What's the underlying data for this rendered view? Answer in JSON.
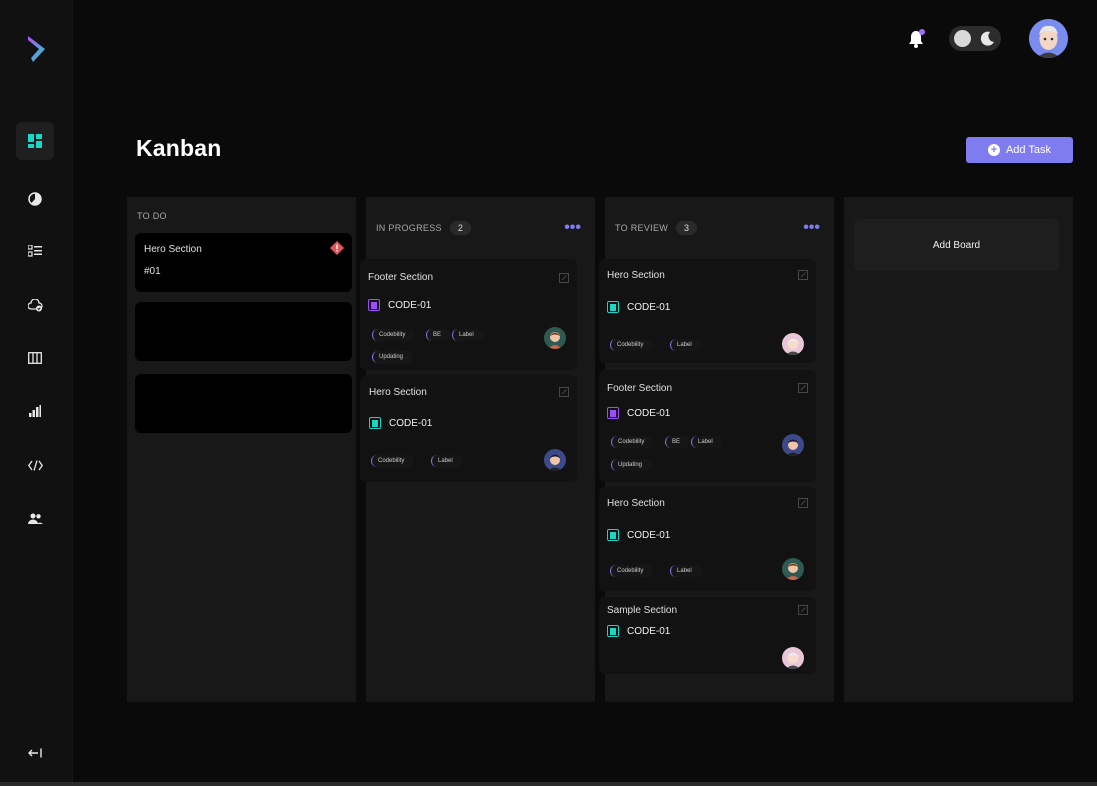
{
  "header": {
    "title": "Kanban",
    "add_task_label": "Add Task",
    "notification_icon": "bell-icon",
    "theme_toggle_icon": "moon-icon"
  },
  "sidebar": {
    "items": [
      {
        "name": "dashboard",
        "icon": "grid-icon",
        "active": true
      },
      {
        "name": "analytics",
        "icon": "pie-chart-icon"
      },
      {
        "name": "tasks",
        "icon": "checklist-icon"
      },
      {
        "name": "cloud",
        "icon": "cloud-check-icon"
      },
      {
        "name": "kanban",
        "icon": "columns-icon"
      },
      {
        "name": "reports",
        "icon": "bar-chart-icon"
      },
      {
        "name": "code",
        "icon": "code-icon"
      },
      {
        "name": "team",
        "icon": "users-icon"
      }
    ],
    "logout_icon": "logout-icon"
  },
  "columns": {
    "todo": {
      "title": "TO DO",
      "cards": [
        {
          "title": "Hero Section",
          "id": "#01",
          "flag_icon": "alert-diamond-icon"
        }
      ]
    },
    "progress": {
      "title": "IN PROGRESS",
      "count": "2",
      "cards": [
        {
          "title": "Footer Section",
          "code": "CODE-01",
          "code_color": "#9b4dff",
          "tags": [
            "Codebility",
            "BE",
            "Label",
            "Updating"
          ]
        },
        {
          "title": "Hero Section",
          "code": "CODE-01",
          "code_color": "#19d7c4",
          "tags": [
            "Codebility",
            "Label"
          ]
        }
      ]
    },
    "review": {
      "title": "TO REVIEW",
      "count": "3",
      "cards": [
        {
          "title": "Hero Section",
          "code": "CODE-01",
          "code_color": "#19d7c4",
          "tags": [
            "Codebility",
            "Label"
          ]
        },
        {
          "title": "Footer Section",
          "code": "CODE-01",
          "code_color": "#9b4dff",
          "tags": [
            "Codebility",
            "BE",
            "Label",
            "Updating"
          ]
        },
        {
          "title": "Hero Section",
          "code": "CODE-01",
          "code_color": "#19d7c4",
          "tags": [
            "Codebility",
            "Label"
          ]
        },
        {
          "title": "Sample Section",
          "code": "CODE-01",
          "code_color": "#19d7c4",
          "tags": []
        }
      ]
    },
    "board": {
      "add_board_label": "Add Board"
    }
  },
  "colors": {
    "accent": "#7f7cf0",
    "teal": "#19d7c4",
    "purple": "#9b4dff",
    "alert": "#e05656"
  }
}
